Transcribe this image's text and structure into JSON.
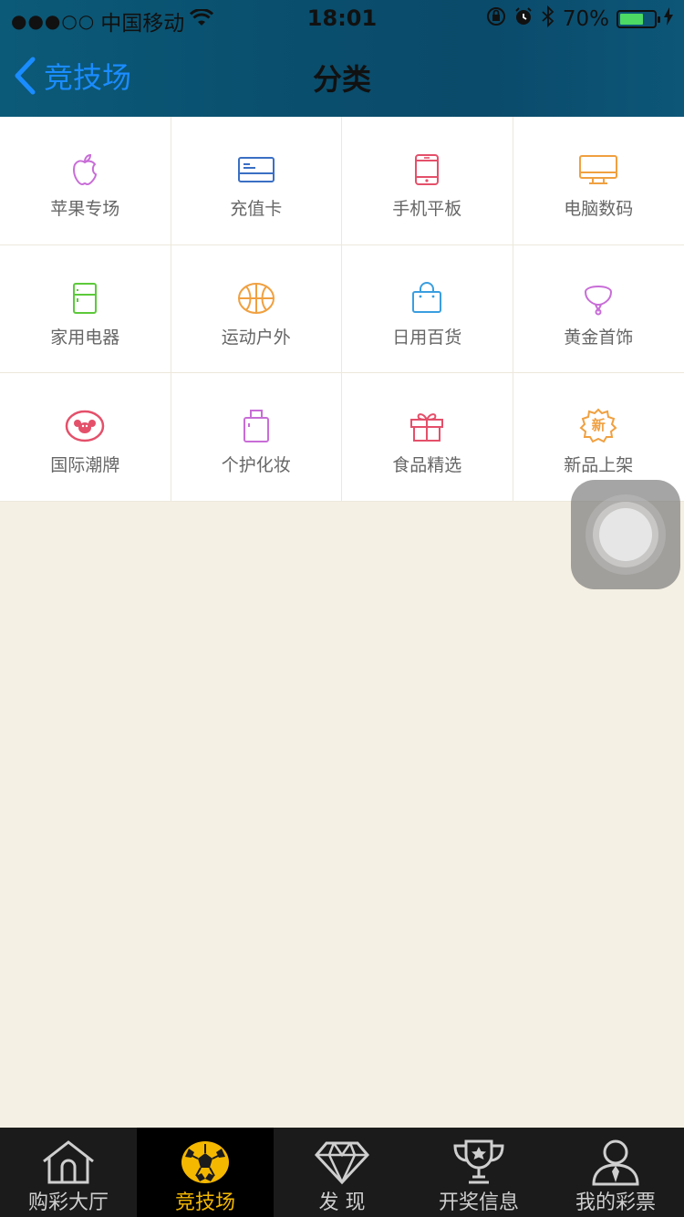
{
  "status_bar": {
    "signal": "●●●○○",
    "carrier": "中国移动",
    "time": "18:01",
    "battery": "70%",
    "battery_level": 0.7
  },
  "nav": {
    "back_label": "竞技场",
    "title": "分类"
  },
  "categories": [
    {
      "label": "苹果专场",
      "icon": "apple-icon",
      "color": "#c86dd7"
    },
    {
      "label": "充值卡",
      "icon": "card-icon",
      "color": "#3a6fc4"
    },
    {
      "label": "手机平板",
      "icon": "phone-icon",
      "color": "#e4506a"
    },
    {
      "label": "电脑数码",
      "icon": "monitor-icon",
      "color": "#f0a040"
    },
    {
      "label": "家用电器",
      "icon": "fridge-icon",
      "color": "#5cc93a"
    },
    {
      "label": "运动户外",
      "icon": "basketball-icon",
      "color": "#f0a040"
    },
    {
      "label": "日用百货",
      "icon": "shopping-bag-icon",
      "color": "#3a9ee0"
    },
    {
      "label": "黄金首饰",
      "icon": "necklace-icon",
      "color": "#c86dd7"
    },
    {
      "label": "国际潮牌",
      "icon": "brand-badge-icon",
      "color": "#e4506a"
    },
    {
      "label": "个护化妆",
      "icon": "cosmetics-icon",
      "color": "#c86dd7"
    },
    {
      "label": "食品精选",
      "icon": "gift-icon",
      "color": "#e4506a"
    },
    {
      "label": "新品上架",
      "icon": "new-badge-icon",
      "color": "#f0a040",
      "badge_text": "新"
    }
  ],
  "tabs": [
    {
      "label": "购彩大厅",
      "icon": "home-icon",
      "active": false
    },
    {
      "label": "竞技场",
      "icon": "soccer-ball-icon",
      "active": true
    },
    {
      "label": "发 现",
      "icon": "diamond-icon",
      "active": false
    },
    {
      "label": "开奖信息",
      "icon": "trophy-icon",
      "active": false
    },
    {
      "label": "我的彩票",
      "icon": "user-icon",
      "active": false
    }
  ],
  "colors": {
    "accent": "#1a8cff",
    "active_tab": "#f5b800",
    "background": "#f5f0e4"
  }
}
